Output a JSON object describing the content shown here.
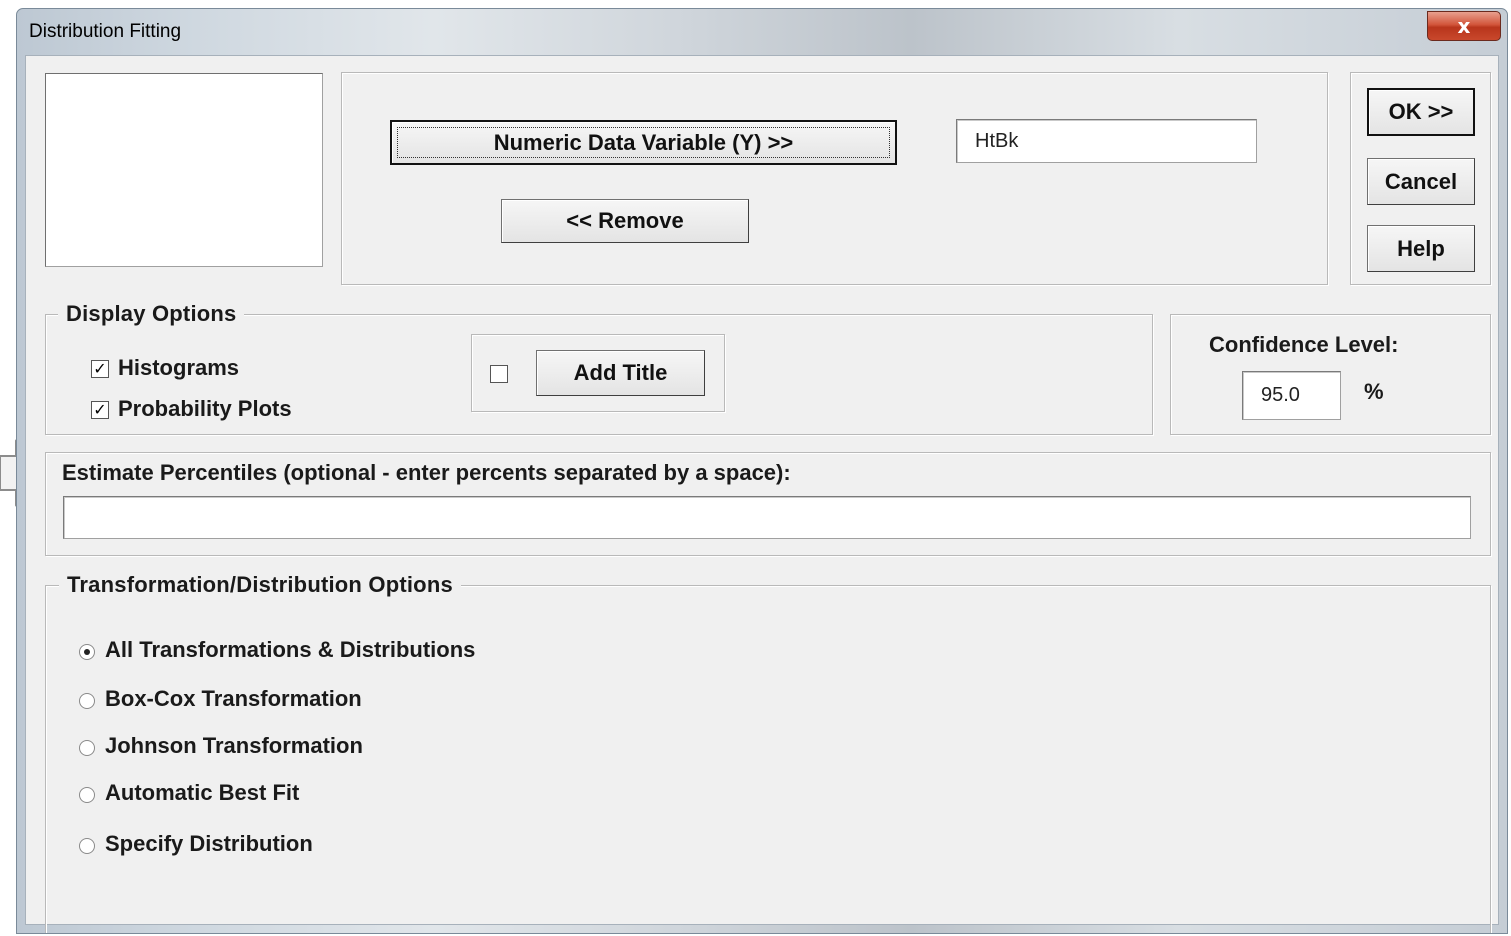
{
  "window": {
    "title": "Distribution Fitting",
    "close_glyph": "x"
  },
  "variable_selection": {
    "variable_list_items": [],
    "numeric_data_button": "Numeric Data Variable (Y) >>",
    "remove_button": "<< Remove",
    "numeric_data_value": "HtBk"
  },
  "actions": {
    "ok": "OK >>",
    "cancel": "Cancel",
    "help": "Help"
  },
  "display_options": {
    "legend": "Display Options",
    "histograms_label": "Histograms",
    "histograms_checked": true,
    "probability_plots_label": "Probability Plots",
    "probability_plots_checked": true,
    "add_title_checked": false,
    "add_title_button": "Add Title"
  },
  "confidence": {
    "label": "Confidence Level:",
    "value": "95.0",
    "unit": "%"
  },
  "percentiles": {
    "label": "Estimate Percentiles (optional - enter percents separated by a space):",
    "value": ""
  },
  "transformation": {
    "legend": "Transformation/Distribution Options",
    "selected_index": 0,
    "options": [
      "All Transformations & Distributions",
      "Box-Cox Transformation",
      "Johnson Transformation",
      "Automatic Best Fit",
      "Specify Distribution"
    ]
  },
  "icons": {
    "pointer_arrow": "arrow-right-icon",
    "checkmark": "✓"
  }
}
